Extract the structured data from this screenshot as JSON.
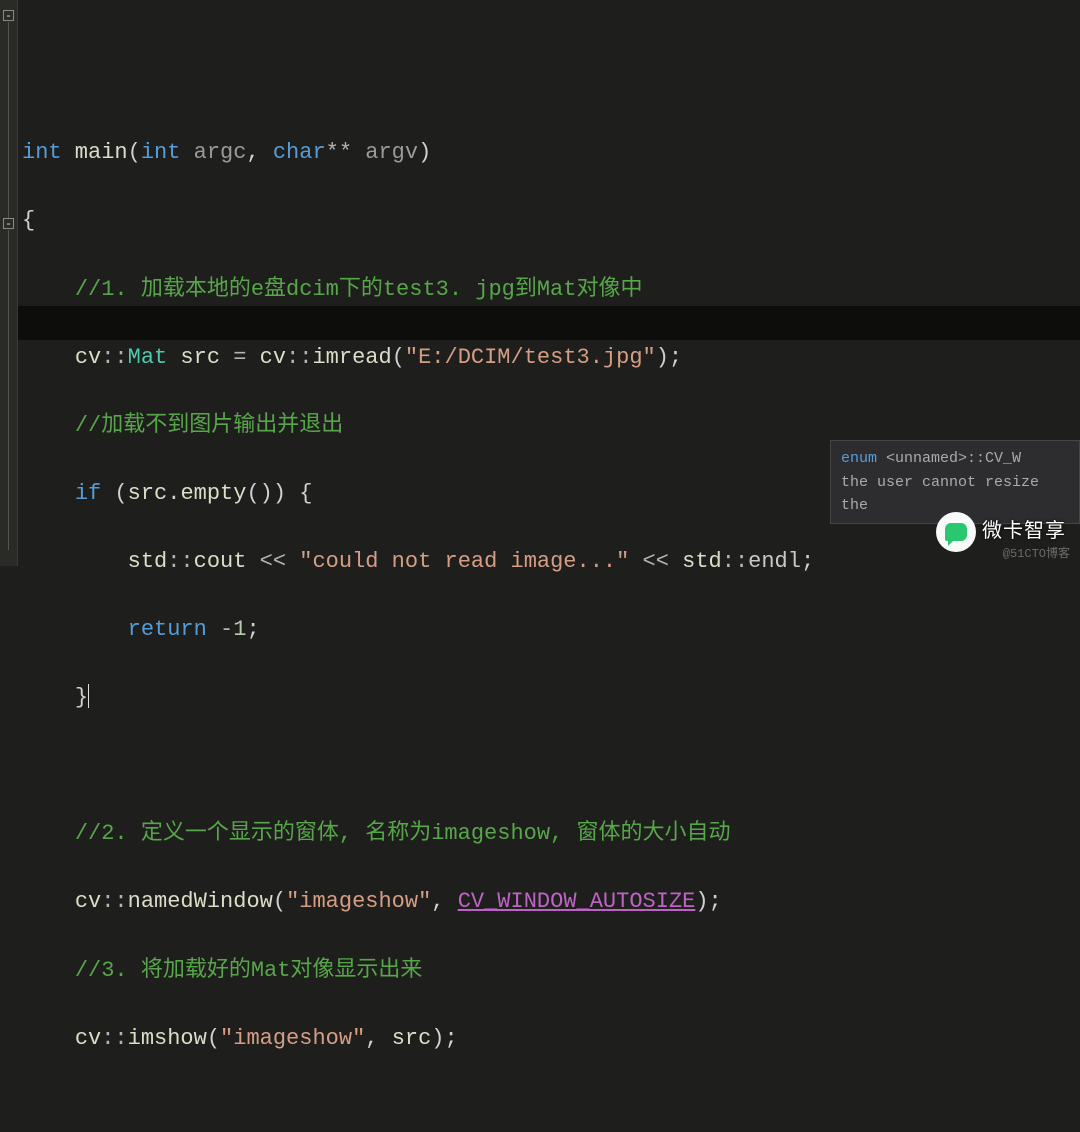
{
  "code": {
    "l1": {
      "int": "int",
      "main": " main",
      "open": "(",
      "int2": "int",
      "argc": " argc",
      "comma": ", ",
      "char": "char",
      "stars": "**",
      "argv": " argv",
      "close": ")"
    },
    "l2": "{",
    "l3": "//1. 加载本地的e盘dcim下的test3. jpg到Mat对像中",
    "l4": {
      "cv": "cv",
      "cc1": "::",
      "Mat": "Mat",
      "src": " src ",
      "eq": "= ",
      "cv2": "cv",
      "cc2": "::",
      "imread": "imread",
      "open": "(",
      "str": "\"E:/DCIM/test3.jpg\"",
      "close": ");"
    },
    "l5": "//加载不到图片输出并退出",
    "l6": {
      "if": "if",
      "sp": " ",
      "open": "(",
      "src": "src",
      "dot": ".",
      "empty": "empty",
      "pp": "()",
      "close": ") ",
      "brace": "{"
    },
    "l7": {
      "std": "std",
      "cc": "::",
      "cout": "cout ",
      "ls1": "<< ",
      "str": "\"could not read image...\"",
      "ls2": " << ",
      "std2": "std",
      "cc2": "::",
      "endl": "endl",
      "semi": ";"
    },
    "l8": {
      "return": "return",
      "sp": " ",
      "neg": "-",
      "one": "1",
      "semi": ";"
    },
    "l9": "}",
    "l11": "//2. 定义一个显示的窗体, 名称为imageshow, 窗体的大小自动",
    "l12": {
      "cv": "cv",
      "cc": "::",
      "nw": "namedWindow",
      "open": "(",
      "str": "\"imageshow\"",
      "comma": ", ",
      "macro": "CV_WINDOW_AUTOSIZE",
      "close": ");"
    },
    "l13": "//3. 将加载好的Mat对像显示出来",
    "l14": {
      "cv": "cv",
      "cc": "::",
      "imshow": "imshow",
      "open": "(",
      "str": "\"imageshow\"",
      "comma": ", ",
      "src": "src",
      "close": ");"
    }
  },
  "tooltip": {
    "enum": "enum ",
    "unnamed": "<unnamed>",
    "tail": "::CV_W",
    "line2": "the user cannot resize the"
  },
  "watermark": "微卡智享",
  "attribution": "@51CTO博客"
}
